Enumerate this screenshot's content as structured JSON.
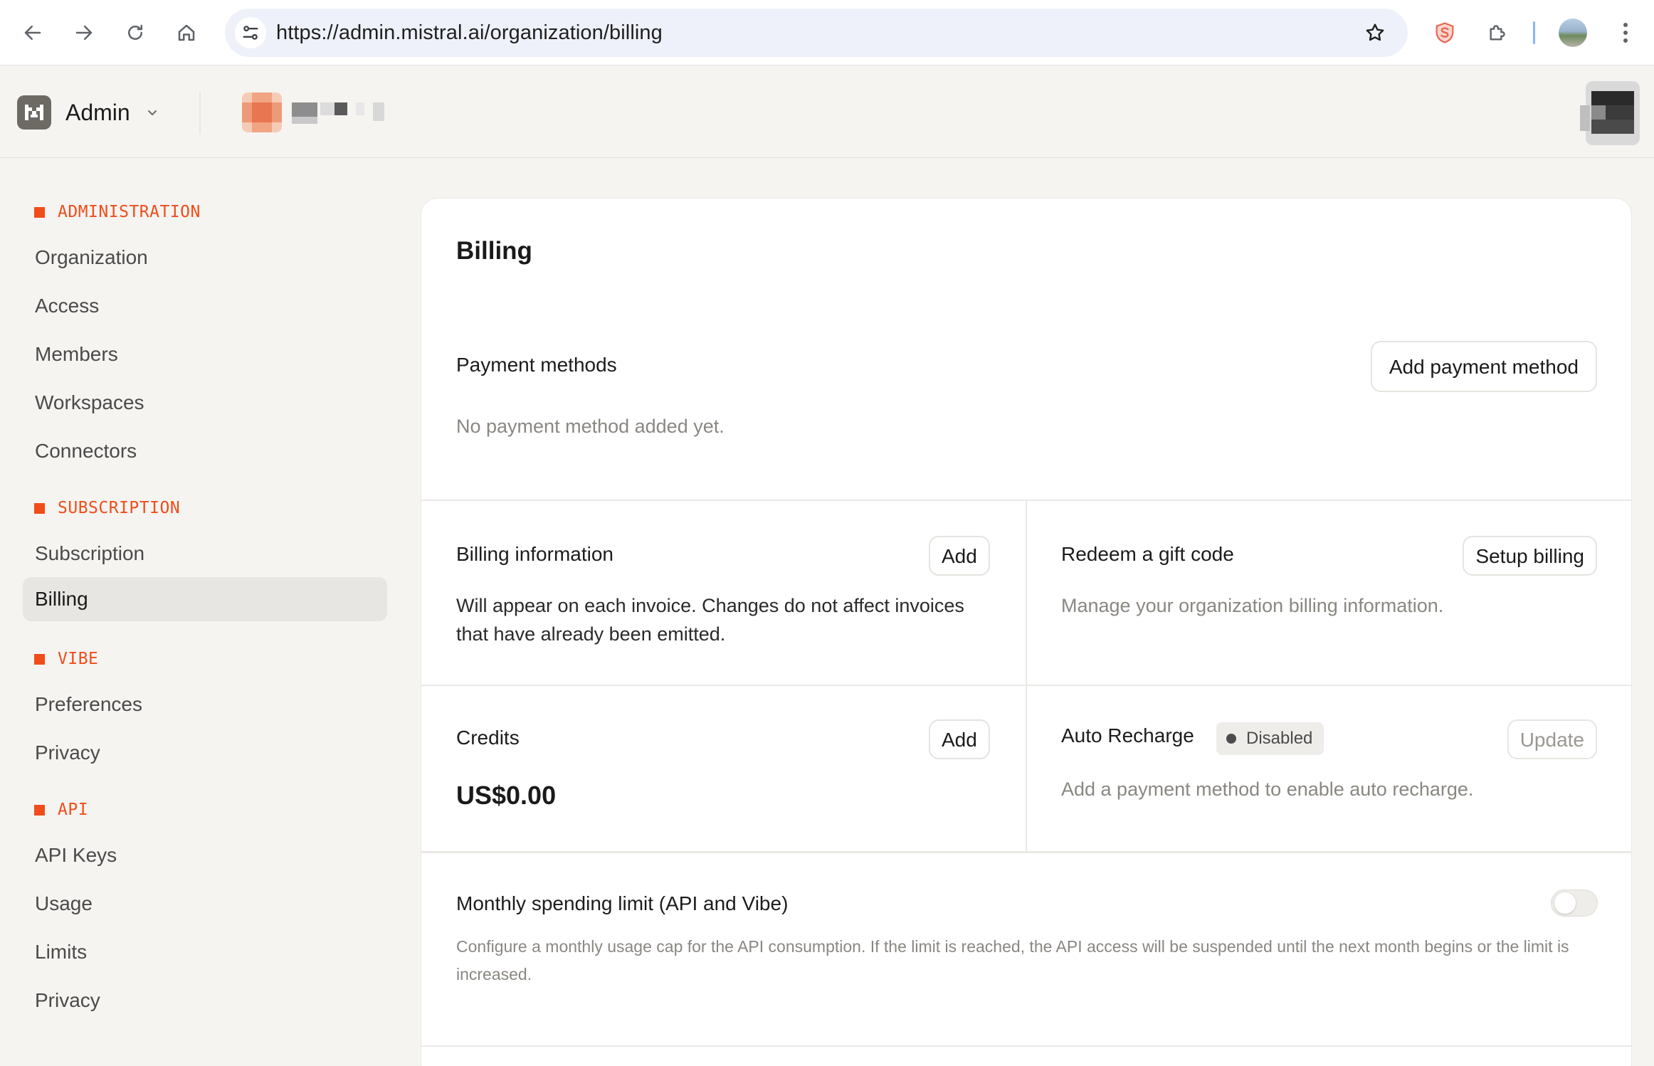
{
  "browser": {
    "url": "https://admin.mistral.ai/organization/billing"
  },
  "header": {
    "app_title": "Admin"
  },
  "sidebar": {
    "sections": [
      {
        "title": "ADMINISTRATION",
        "items": [
          "Organization",
          "Access",
          "Members",
          "Workspaces",
          "Connectors"
        ]
      },
      {
        "title": "SUBSCRIPTION",
        "items": [
          "Subscription",
          "Billing"
        ]
      },
      {
        "title": "VIBE",
        "items": [
          "Preferences",
          "Privacy"
        ]
      },
      {
        "title": "API",
        "items": [
          "API Keys",
          "Usage",
          "Limits",
          "Privacy"
        ]
      }
    ],
    "active_item": "Billing"
  },
  "main": {
    "title": "Billing",
    "payment_methods": {
      "title": "Payment methods",
      "button": "Add payment method",
      "empty_text": "No payment method added yet."
    },
    "billing_information": {
      "title": "Billing information",
      "button": "Add",
      "description": "Will appear on each invoice. Changes do not affect invoices that have already been emitted."
    },
    "gift_code": {
      "title": "Redeem a gift code",
      "button": "Setup billing",
      "description": "Manage your organization billing information."
    },
    "credits": {
      "title": "Credits",
      "button": "Add",
      "amount": "US$0.00"
    },
    "auto_recharge": {
      "title": "Auto Recharge",
      "status": "Disabled",
      "button": "Update",
      "description": "Add a payment method to enable auto recharge."
    },
    "spending_limit": {
      "title": "Monthly spending limit (API and Vibe)",
      "enabled": false,
      "description": "Configure a monthly usage cap for the API consumption. If the limit is reached, the API access will be suspended until the next month begins or the limit is increased."
    }
  },
  "colors": {
    "accent": "#f04d1a",
    "background": "#f5f4f1",
    "card": "#ffffff"
  }
}
